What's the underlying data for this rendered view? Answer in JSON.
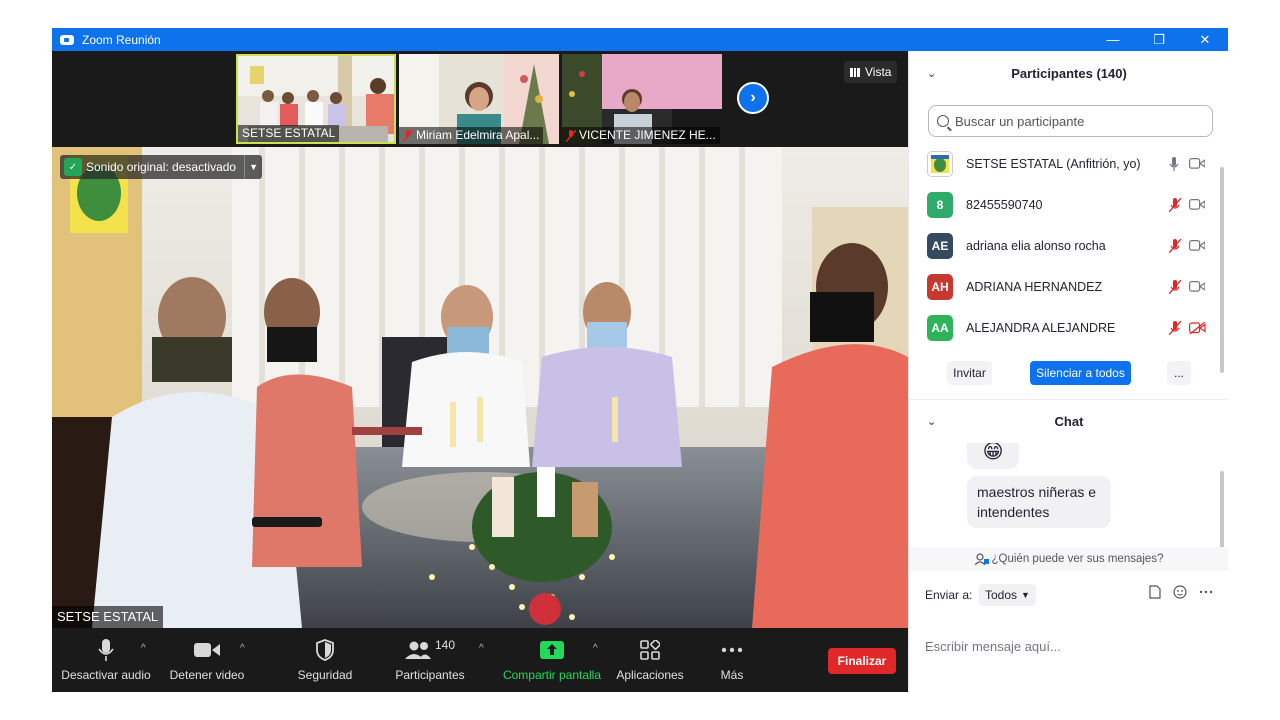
{
  "window": {
    "title": "Zoom Reunión",
    "minimize_glyph": "—",
    "restore_glyph": "❐",
    "close_glyph": "✕"
  },
  "filmstrip": {
    "thumbs": [
      {
        "name": "SETSE ESTATAL",
        "muted": false
      },
      {
        "name": "Miriam Edelmira Apal...",
        "muted": true
      },
      {
        "name": "VICENTE JIMENEZ HE...",
        "muted": true
      }
    ],
    "next_icon": "chevron-right-icon",
    "view_label": "Vista"
  },
  "video": {
    "original_sound": "Sonido original: desactivado",
    "speaker_name": "SETSE ESTATAL"
  },
  "toolbar": {
    "mute_audio": "Desactivar audio",
    "stop_video": "Detener video",
    "security": "Seguridad",
    "participants": "Participantes",
    "participants_count": "140",
    "share_screen": "Compartir pantalla",
    "apps": "Aplicaciones",
    "more": "Más",
    "end": "Finalizar",
    "colors": {
      "share": "#23d959",
      "end": "#e02828"
    }
  },
  "participants_panel": {
    "title": "Participantes (140)",
    "search_placeholder": "Buscar un participante",
    "list": [
      {
        "initials": "",
        "name": "SETSE ESTATAL (Anfitrión, yo)",
        "color": "#ffffff",
        "mic": "on",
        "cam": "on"
      },
      {
        "initials": "8",
        "name": "82455590740",
        "color": "#2eab6b",
        "mic": "muted",
        "cam": "on"
      },
      {
        "initials": "AE",
        "name": "adriana elia alonso rocha",
        "color": "#35495f",
        "mic": "muted",
        "cam": "on"
      },
      {
        "initials": "AH",
        "name": "ADRIANA HERNANDEZ",
        "color": "#c7392e",
        "mic": "muted",
        "cam": "on"
      },
      {
        "initials": "AA",
        "name": "ALEJANDRA ALEJANDRE",
        "color": "#2eb35a",
        "mic": "muted",
        "cam": "off"
      }
    ],
    "invite": "Invitar",
    "mute_all": "Silenciar a todos",
    "more": "..."
  },
  "chat_panel": {
    "title": "Chat",
    "emoji_label": "😁",
    "message": "maestros niñeras e intendentes",
    "who_can_see": "¿Quién puede ver sus mensajes?",
    "send_to_label": "Enviar a:",
    "send_to_value": "Todos",
    "input_placeholder": "Escribir mensaje aquí..."
  }
}
